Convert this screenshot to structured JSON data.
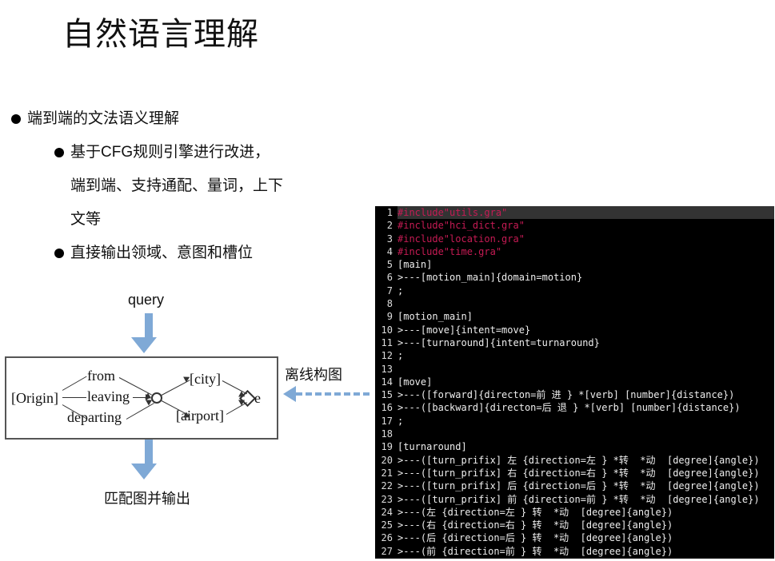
{
  "title": "自然语言理解",
  "bullets": {
    "b1": "端到端的文法语义理解",
    "b2": "基于CFG规则引擎进行改进，",
    "b2c1": "端到端、支持通配、量词，上下",
    "b2c2": "文等",
    "b3": "直接输出领域、意图和槽位"
  },
  "labels": {
    "query": "query",
    "offline": "离线构图",
    "match": "匹配图并输出"
  },
  "grammar": {
    "origin": "[Origin]",
    "from": "from",
    "leaving": "leaving",
    "departing": "departing",
    "city": "[city]",
    "airport": "[airport]",
    "e": "e"
  },
  "code": [
    {
      "n": "1",
      "cls": "include sel",
      "t": "#include\"utils.gra\""
    },
    {
      "n": "2",
      "cls": "include",
      "t": "#include\"hci_dict.gra\""
    },
    {
      "n": "3",
      "cls": "include",
      "t": "#include\"location.gra\""
    },
    {
      "n": "4",
      "cls": "include",
      "t": "#include\"time.gra\""
    },
    {
      "n": "5",
      "cls": "",
      "t": "[main]"
    },
    {
      "n": "6",
      "cls": "",
      "t": ">---[motion_main]{domain=motion}"
    },
    {
      "n": "7",
      "cls": "",
      "t": ";"
    },
    {
      "n": "8",
      "cls": "",
      "t": ""
    },
    {
      "n": "9",
      "cls": "",
      "t": "[motion_main]"
    },
    {
      "n": "10",
      "cls": "",
      "t": ">---[move]{intent=move}"
    },
    {
      "n": "11",
      "cls": "",
      "t": ">---[turnaround]{intent=turnaround}"
    },
    {
      "n": "12",
      "cls": "",
      "t": ";"
    },
    {
      "n": "13",
      "cls": "",
      "t": ""
    },
    {
      "n": "14",
      "cls": "",
      "t": "[move]"
    },
    {
      "n": "15",
      "cls": "",
      "t": ">---([forward]{directon=前 进 } *[verb] [number]{distance})"
    },
    {
      "n": "16",
      "cls": "",
      "t": ">---([backward]{directon=后 退 } *[verb] [number]{distance})"
    },
    {
      "n": "17",
      "cls": "",
      "t": ";"
    },
    {
      "n": "18",
      "cls": "",
      "t": ""
    },
    {
      "n": "19",
      "cls": "",
      "t": "[turnaround]"
    },
    {
      "n": "20",
      "cls": "",
      "t": ">---([turn_prifix] 左 {direction=左 } *转  *动  [degree]{angle})"
    },
    {
      "n": "21",
      "cls": "",
      "t": ">---([turn_prifix] 右 {direction=右 } *转  *动  [degree]{angle})"
    },
    {
      "n": "22",
      "cls": "",
      "t": ">---([turn_prifix] 后 {direction=后 } *转  *动  [degree]{angle})"
    },
    {
      "n": "23",
      "cls": "",
      "t": ">---([turn_prifix] 前 {direction=前 } *转  *动  [degree]{angle})"
    },
    {
      "n": "24",
      "cls": "",
      "t": ">---(左 {direction=左 } 转  *动  [degree]{angle})"
    },
    {
      "n": "25",
      "cls": "",
      "t": ">---(右 {direction=右 } 转  *动  [degree]{angle})"
    },
    {
      "n": "26",
      "cls": "",
      "t": ">---(后 {direction=后 } 转  *动  [degree]{angle})"
    },
    {
      "n": "27",
      "cls": "",
      "t": ">---(前 {direction=前 } 转  *动  [degree]{angle})"
    }
  ]
}
